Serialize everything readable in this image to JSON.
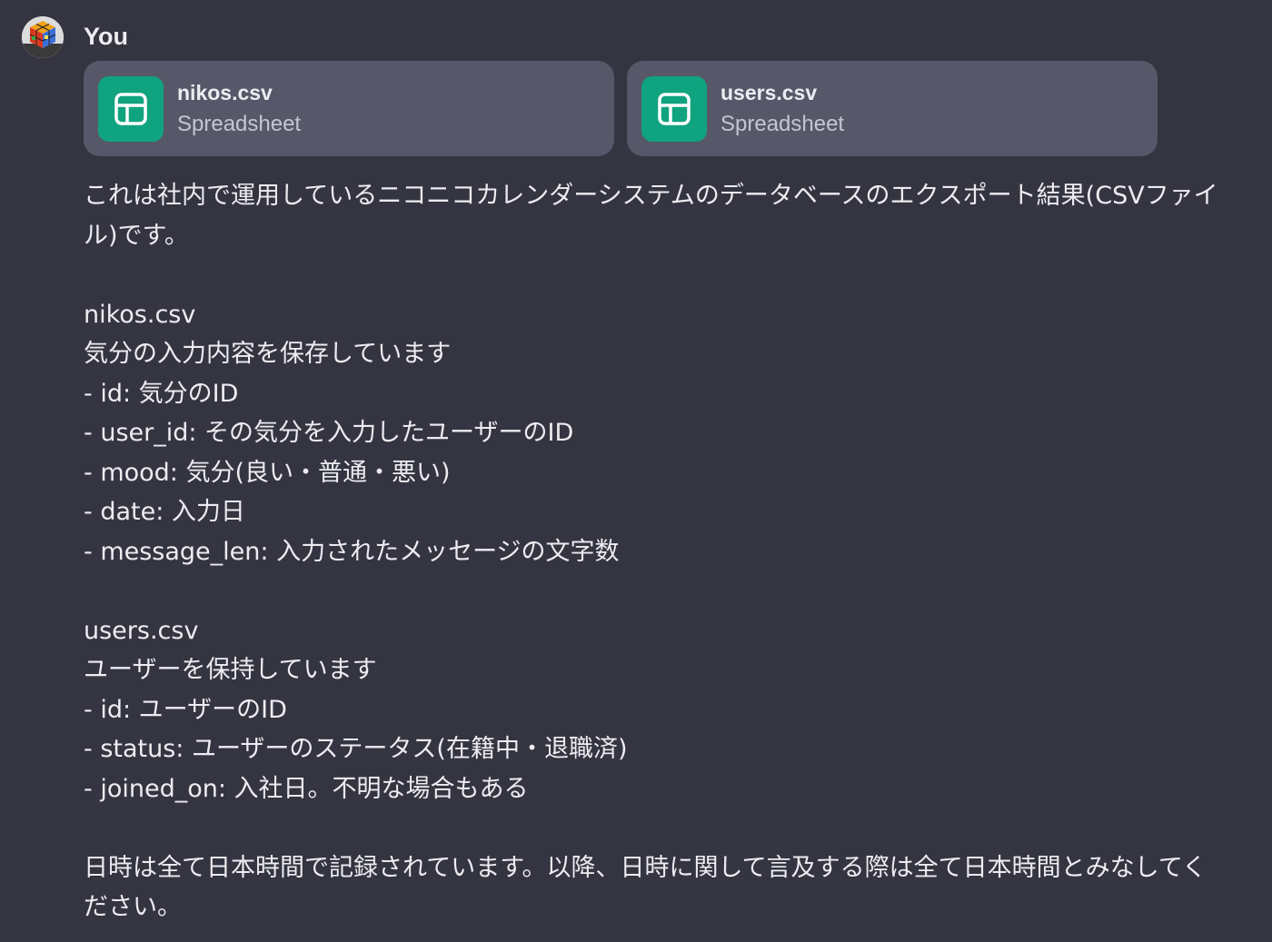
{
  "author": {
    "name": "You",
    "avatar_icon": "avatar-cube-icon"
  },
  "attachments": [
    {
      "name": "nikos.csv",
      "type": "Spreadsheet",
      "icon": "spreadsheet-icon"
    },
    {
      "name": "users.csv",
      "type": "Spreadsheet",
      "icon": "spreadsheet-icon"
    }
  ],
  "paragraphs": [
    "これは社内で運用しているニコニコカレンダーシステムのデータベースのエクスポート結果(CSVファイル)です。",
    "nikos.csv\n気分の入力内容を保存しています\n- id: 気分のID\n- user_id: その気分を入力したユーザーのID\n- mood: 気分(良い・普通・悪い)\n- date: 入力日\n- message_len: 入力されたメッセージの文字数",
    "users.csv\nユーザーを保持しています\n- id: ユーザーのID\n- status: ユーザーのステータス(在籍中・退職済)\n- joined_on: 入社日。不明な場合もある",
    "日時は全て日本時間で記録されています。以降、日時に関して言及する際は全て日本時間とみなしてください。"
  ],
  "colors": {
    "background": "#343541",
    "card": "#565869",
    "icon_bg": "#10a37f",
    "text": "#ececf1",
    "muted": "#c5c5d2"
  }
}
